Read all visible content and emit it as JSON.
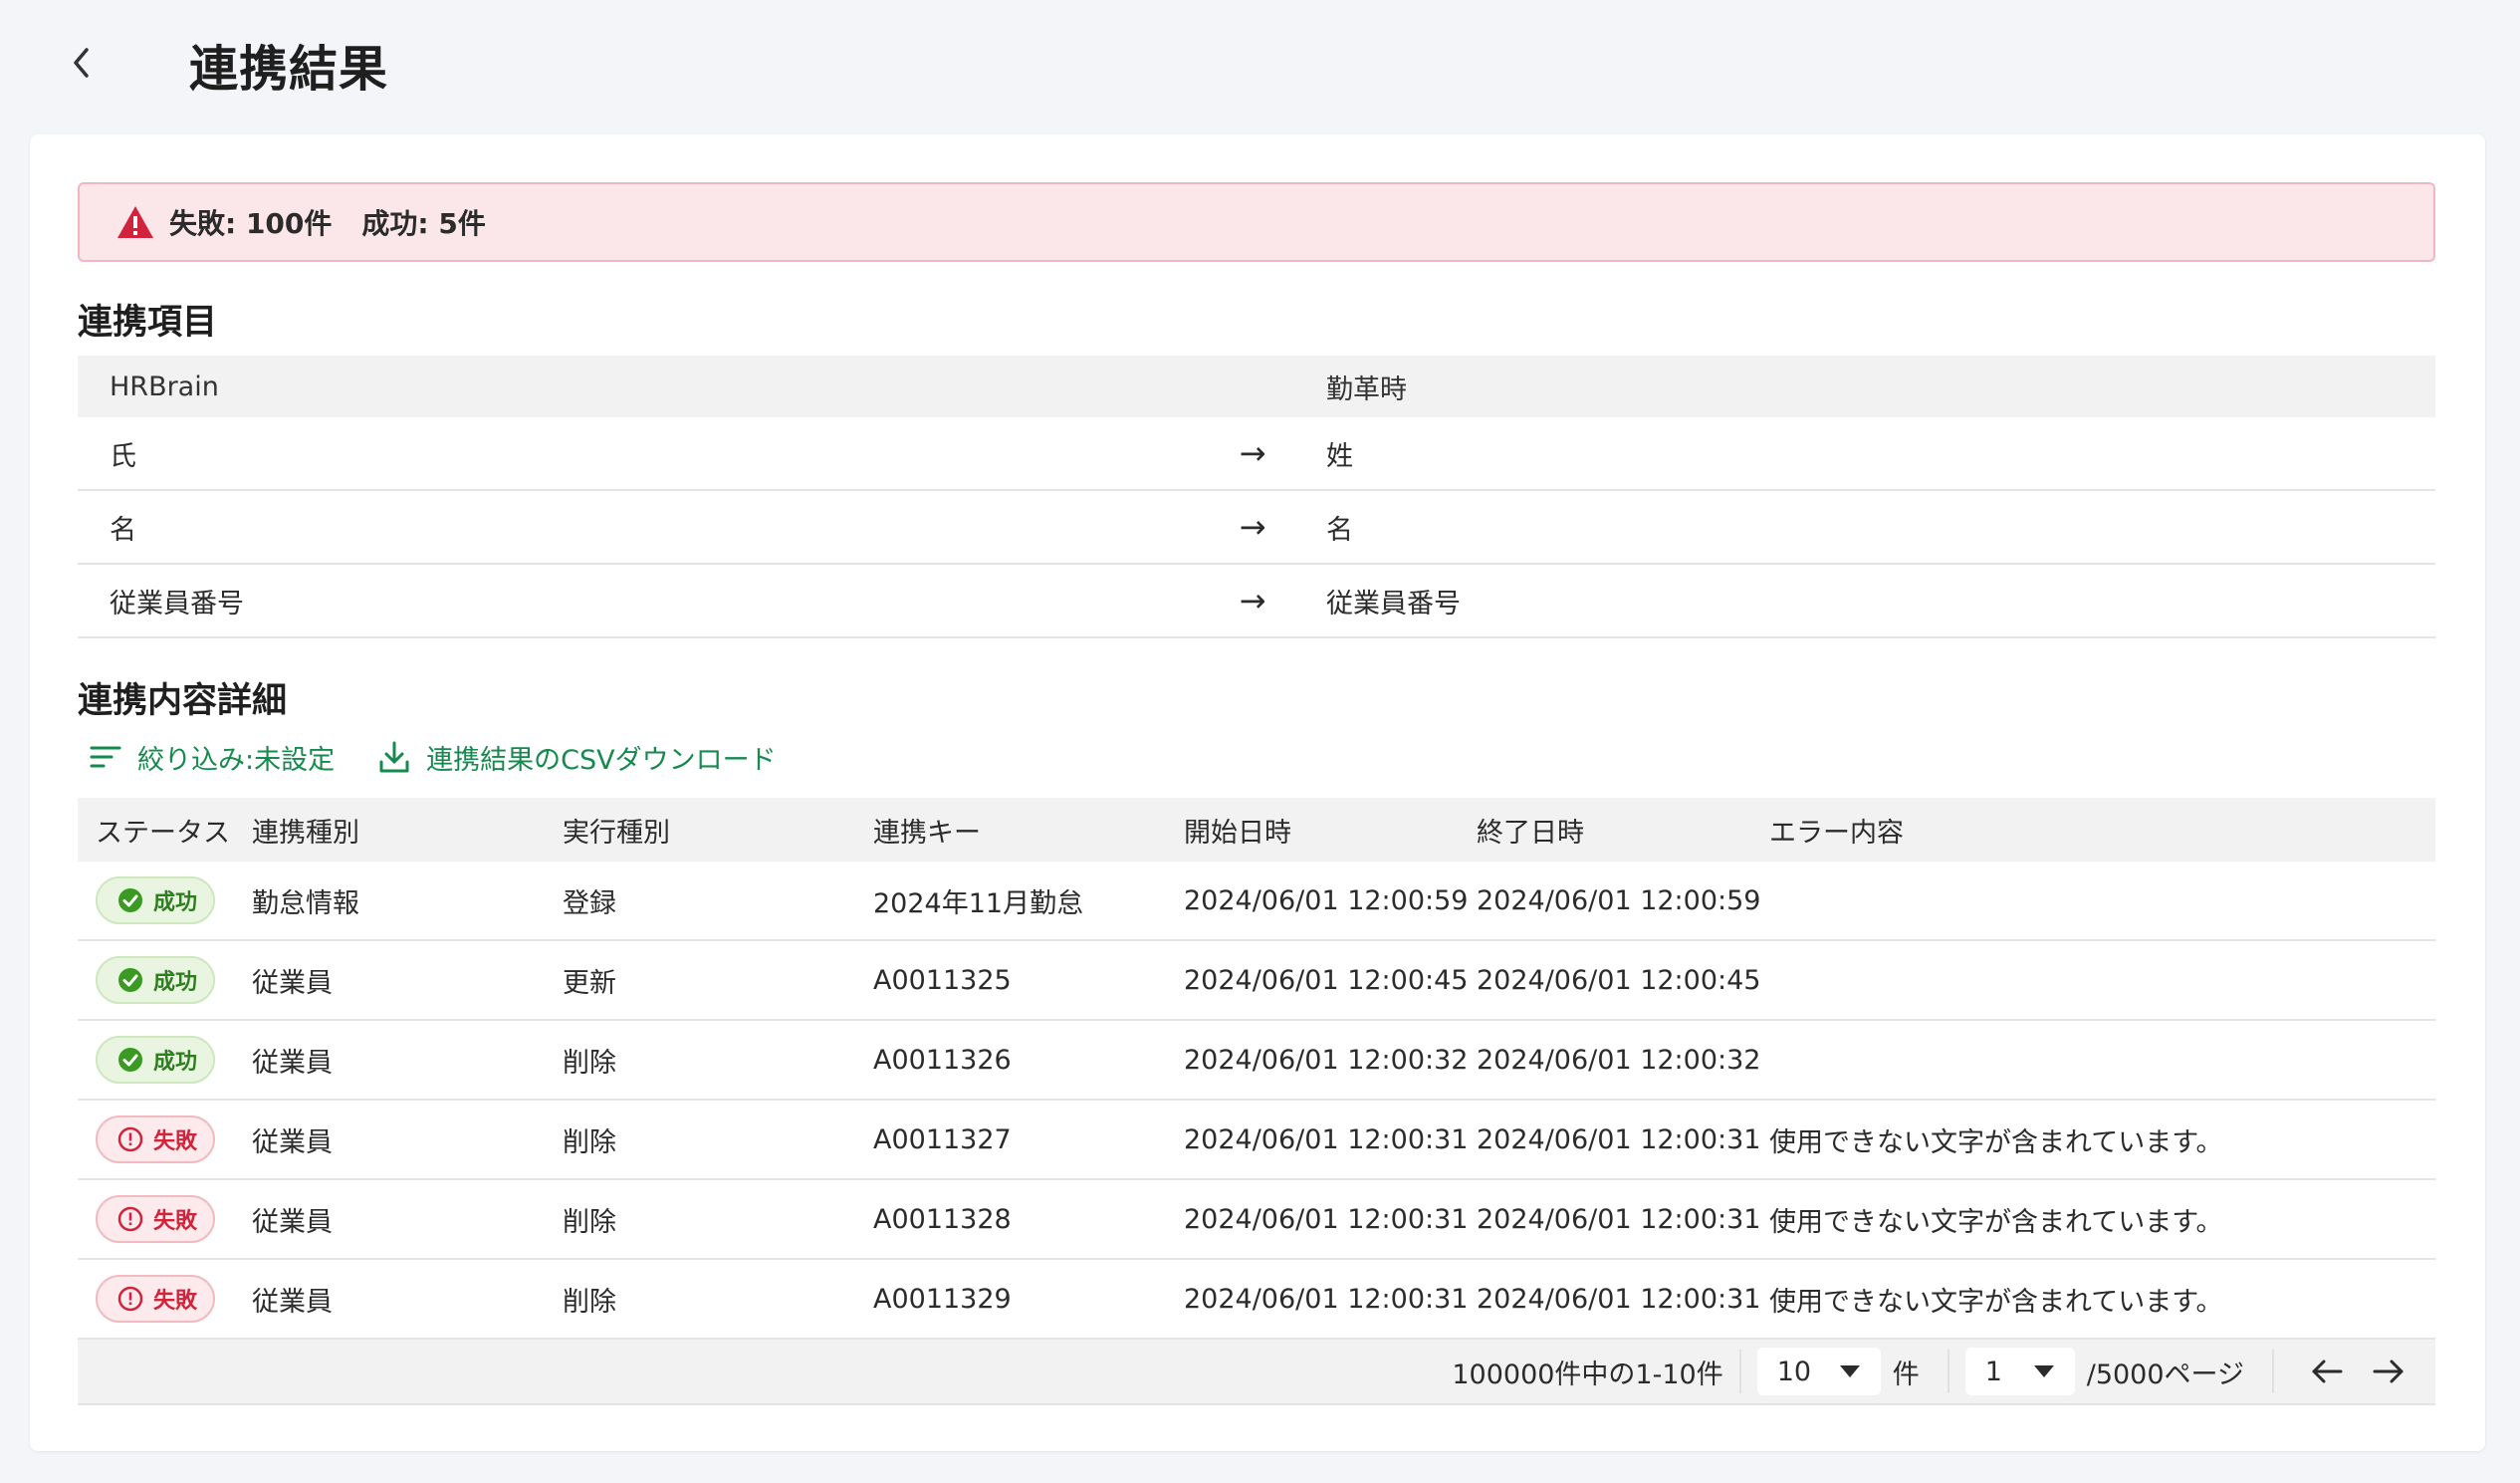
{
  "header": {
    "title": "連携結果"
  },
  "alert": {
    "failure": "失敗: 100件",
    "success": "成功: 5件"
  },
  "mapping": {
    "section_title": "連携項目",
    "head": {
      "source": "HRBrain",
      "target": "勤革時"
    },
    "rows": [
      {
        "source": "氏",
        "arrow": "→",
        "target": "姓"
      },
      {
        "source": "名",
        "arrow": "→",
        "target": "名"
      },
      {
        "source": "従業員番号",
        "arrow": "→",
        "target": "従業員番号"
      }
    ]
  },
  "details": {
    "section_title": "連携内容詳細",
    "filter_label": "絞り込み:未設定",
    "download_label": "連携結果のCSVダウンロード",
    "columns": [
      "ステータス",
      "連携種別",
      "実行種別",
      "連携キー",
      "開始日時",
      "終了日時",
      "エラー内容"
    ],
    "rows": [
      {
        "status": "成功",
        "type": "勤怠情報",
        "exec": "登録",
        "key": "2024年11月勤怠",
        "start": "2024/06/01 12:00:59",
        "end": "2024/06/01 12:00:59",
        "error": ""
      },
      {
        "status": "成功",
        "type": "従業員",
        "exec": "更新",
        "key": "A0011325",
        "start": "2024/06/01 12:00:45",
        "end": "2024/06/01 12:00:45",
        "error": ""
      },
      {
        "status": "成功",
        "type": "従業員",
        "exec": "削除",
        "key": "A0011326",
        "start": "2024/06/01 12:00:32",
        "end": "2024/06/01 12:00:32",
        "error": ""
      },
      {
        "status": "失敗",
        "type": "従業員",
        "exec": "削除",
        "key": "A0011327",
        "start": "2024/06/01 12:00:31",
        "end": "2024/06/01 12:00:31",
        "error": "使用できない文字が含まれています。"
      },
      {
        "status": "失敗",
        "type": "従業員",
        "exec": "削除",
        "key": "A0011328",
        "start": "2024/06/01 12:00:31",
        "end": "2024/06/01 12:00:31",
        "error": "使用できない文字が含まれています。"
      },
      {
        "status": "失敗",
        "type": "従業員",
        "exec": "削除",
        "key": "A0011329",
        "start": "2024/06/01 12:00:31",
        "end": "2024/06/01 12:00:31",
        "error": "使用できない文字が含まれています。"
      }
    ]
  },
  "pagination": {
    "range_text": "100000件中の1-10件",
    "per_page": "10",
    "per_page_unit": "件",
    "page": "1",
    "page_total": "/5000ページ"
  },
  "colors": {
    "success": "#2e7d1f",
    "failure": "#d1243c",
    "link": "#168a4e"
  }
}
